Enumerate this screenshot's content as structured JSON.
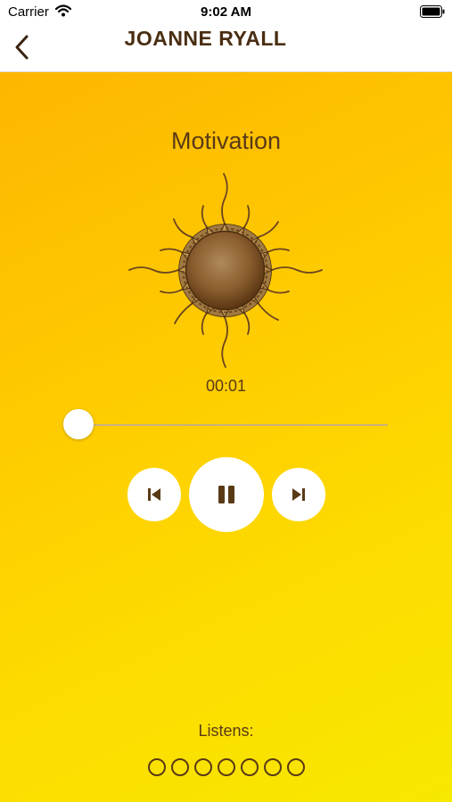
{
  "status_bar": {
    "carrier": "Carrier",
    "time": "9:02 AM"
  },
  "nav": {
    "title": "JOANNE RYALL",
    "back_icon": "chevron-left-icon"
  },
  "player": {
    "track_title": "Motivation",
    "artwork_icon": "sun-icon",
    "elapsed": "00:01",
    "progress": 0.0,
    "controls": {
      "previous_icon": "skip-previous-icon",
      "pause_icon": "pause-icon",
      "next_icon": "skip-next-icon"
    }
  },
  "listens": {
    "label": "Listens:",
    "count_slots": 7,
    "filled": 0
  },
  "colors": {
    "accent_brown": "#5a3a16",
    "gradient_start": "#fdb600",
    "gradient_end": "#f7e800"
  }
}
